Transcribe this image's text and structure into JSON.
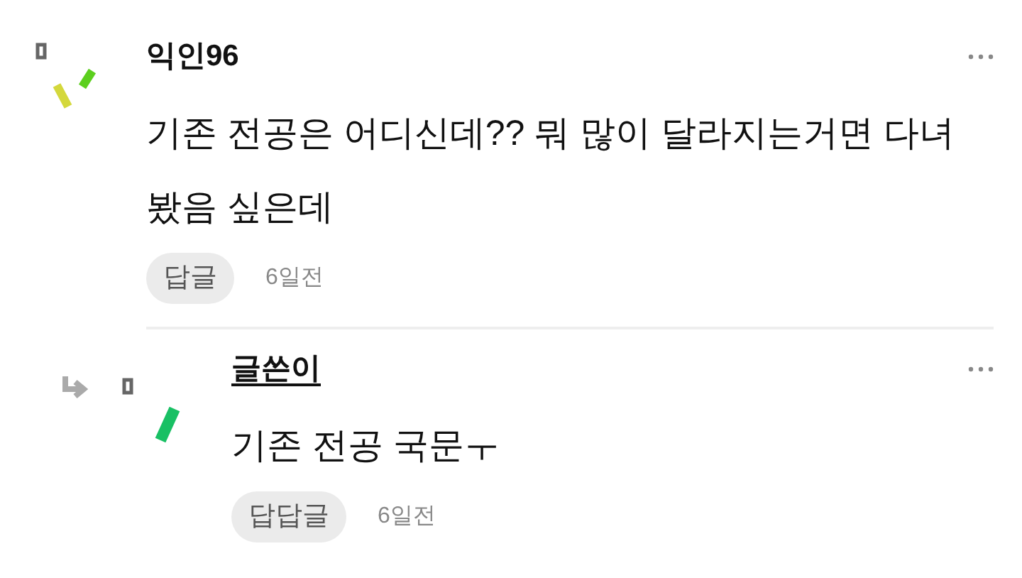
{
  "comments": [
    {
      "author": "익인96",
      "author_underlined": false,
      "text": "기존 전공은 어디신데?? 뭐 많이 달라지는거면 다녀봤음 싶은데",
      "reply_label": "답글",
      "time": "6일전",
      "children": [
        {
          "author": "글쓴이",
          "author_underlined": true,
          "text": "기존 전공 국문ㅜ",
          "reply_label": "답답글",
          "time": "6일전"
        }
      ]
    }
  ]
}
